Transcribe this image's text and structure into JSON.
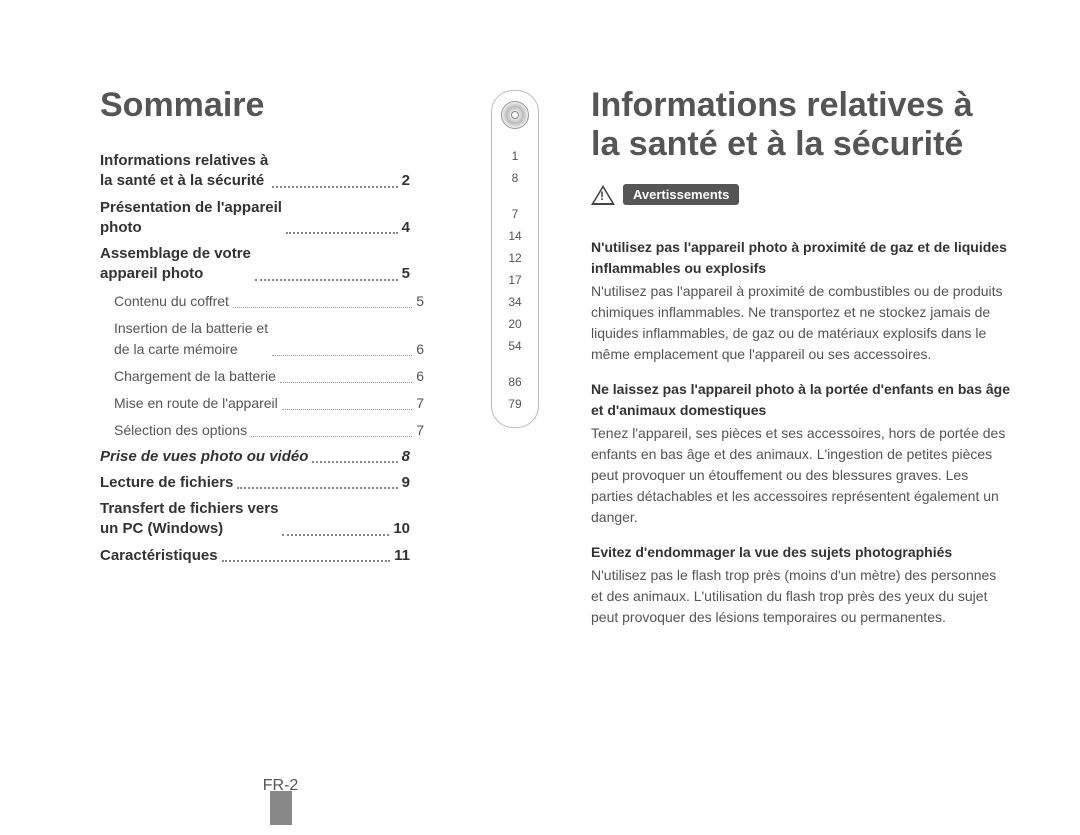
{
  "left": {
    "heading": "Sommaire",
    "toc_main": [
      {
        "label": "Informations relatives à\nla santé et à la sécurité",
        "page": "2"
      },
      {
        "label": "Présentation de l'appareil\nphoto",
        "page": "4"
      },
      {
        "label": "Assemblage de votre\nappareil photo",
        "page": "5"
      }
    ],
    "toc_sub": [
      {
        "label": "Contenu du coffret",
        "page": "5"
      },
      {
        "label": "Insertion de la batterie et\nde la carte mémoire",
        "page": "6"
      },
      {
        "label": "Chargement de la batterie",
        "page": "6"
      },
      {
        "label": "Mise en route de l'appareil",
        "page": "7"
      },
      {
        "label": "Sélection des options",
        "page": "7"
      }
    ],
    "toc_main2": [
      {
        "label": "Prise de vues photo ou vidéo",
        "page": "8",
        "italic": true
      },
      {
        "label": "Lecture de fichiers",
        "page": "9"
      },
      {
        "label": "Transfert de fichiers vers\nun PC (Windows)",
        "page": "10"
      },
      {
        "label": "Caractéristiques",
        "page": "11"
      }
    ],
    "full_ref_pages": [
      "1",
      "8",
      "",
      "7",
      "14",
      "12",
      "17",
      "34",
      "20",
      "54",
      "",
      "86",
      "79"
    ],
    "footer": "FR-2"
  },
  "right": {
    "heading": "Informations relatives à la santé et à la sécurité",
    "badge": "Avertissements",
    "sections": [
      {
        "title": "N'utilisez pas l'appareil photo à proximité de gaz et de liquides inflammables ou explosifs",
        "body": "N'utilisez pas l'appareil à proximité de combustibles ou de produits chimiques inflammables. Ne transportez et ne stockez jamais de liquides inflammables, de gaz ou de matériaux explosifs dans le même emplacement que l'appareil ou ses accessoires."
      },
      {
        "title": "Ne laissez pas l'appareil photo à la portée d'enfants en bas âge et d'animaux domestiques",
        "body": "Tenez l'appareil, ses pièces et ses accessoires, hors de portée des enfants en bas âge et des animaux. L'ingestion de petites pièces peut provoquer un étouffement ou des blessures graves. Les parties détachables et les accessoires représentent également un danger."
      },
      {
        "title": "Evitez d'endommager la vue des sujets photographiés",
        "body": "N'utilisez pas le flash trop près (moins d'un mètre) des personnes et des animaux. L'utilisation du flash trop près des yeux du sujet peut provoquer des lésions temporaires ou permanentes."
      }
    ]
  }
}
